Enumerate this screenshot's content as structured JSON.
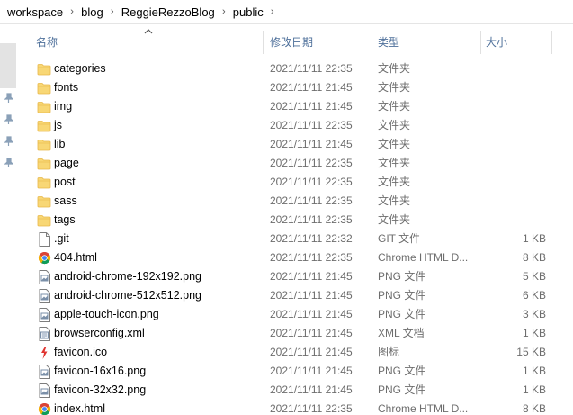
{
  "breadcrumb": [
    "workspace",
    "blog",
    "ReggieRezzoBlog",
    "public"
  ],
  "columns": {
    "name": "名称",
    "modified": "修改日期",
    "type": "类型",
    "size": "大小"
  },
  "sort": {
    "column": "name",
    "direction": "ascending"
  },
  "colors": {
    "folder": "#f8d775",
    "folder_dark": "#e8b84a",
    "header_text": "#4d6f9a",
    "meta_text": "#6d6d6d",
    "ico_red": "#e0332f"
  },
  "files": [
    {
      "name": "categories",
      "modified": "2021/11/11 22:35",
      "type": "文件夹",
      "size": "",
      "icon": "folder-icon"
    },
    {
      "name": "fonts",
      "modified": "2021/11/11 21:45",
      "type": "文件夹",
      "size": "",
      "icon": "folder-icon"
    },
    {
      "name": "img",
      "modified": "2021/11/11 21:45",
      "type": "文件夹",
      "size": "",
      "icon": "folder-icon"
    },
    {
      "name": "js",
      "modified": "2021/11/11 22:35",
      "type": "文件夹",
      "size": "",
      "icon": "folder-icon"
    },
    {
      "name": "lib",
      "modified": "2021/11/11 21:45",
      "type": "文件夹",
      "size": "",
      "icon": "folder-icon"
    },
    {
      "name": "page",
      "modified": "2021/11/11 22:35",
      "type": "文件夹",
      "size": "",
      "icon": "folder-icon"
    },
    {
      "name": "post",
      "modified": "2021/11/11 22:35",
      "type": "文件夹",
      "size": "",
      "icon": "folder-icon"
    },
    {
      "name": "sass",
      "modified": "2021/11/11 22:35",
      "type": "文件夹",
      "size": "",
      "icon": "folder-icon"
    },
    {
      "name": "tags",
      "modified": "2021/11/11 22:35",
      "type": "文件夹",
      "size": "",
      "icon": "folder-icon"
    },
    {
      "name": ".git",
      "modified": "2021/11/11 22:32",
      "type": "GIT 文件",
      "size": "1 KB",
      "icon": "blank-file-icon"
    },
    {
      "name": "404.html",
      "modified": "2021/11/11 22:35",
      "type": "Chrome HTML D...",
      "size": "8 KB",
      "icon": "chrome-icon"
    },
    {
      "name": "android-chrome-192x192.png",
      "modified": "2021/11/11 21:45",
      "type": "PNG 文件",
      "size": "5 KB",
      "icon": "image-file-icon"
    },
    {
      "name": "android-chrome-512x512.png",
      "modified": "2021/11/11 21:45",
      "type": "PNG 文件",
      "size": "6 KB",
      "icon": "image-file-icon"
    },
    {
      "name": "apple-touch-icon.png",
      "modified": "2021/11/11 21:45",
      "type": "PNG 文件",
      "size": "3 KB",
      "icon": "image-file-icon"
    },
    {
      "name": "browserconfig.xml",
      "modified": "2021/11/11 21:45",
      "type": "XML 文档",
      "size": "1 KB",
      "icon": "xml-file-icon"
    },
    {
      "name": "favicon.ico",
      "modified": "2021/11/11 21:45",
      "type": "图标",
      "size": "15 KB",
      "icon": "ico-file-icon"
    },
    {
      "name": "favicon-16x16.png",
      "modified": "2021/11/11 21:45",
      "type": "PNG 文件",
      "size": "1 KB",
      "icon": "image-file-icon"
    },
    {
      "name": "favicon-32x32.png",
      "modified": "2021/11/11 21:45",
      "type": "PNG 文件",
      "size": "1 KB",
      "icon": "image-file-icon"
    },
    {
      "name": "index.html",
      "modified": "2021/11/11 22:35",
      "type": "Chrome HTML D...",
      "size": "8 KB",
      "icon": "chrome-icon"
    }
  ]
}
